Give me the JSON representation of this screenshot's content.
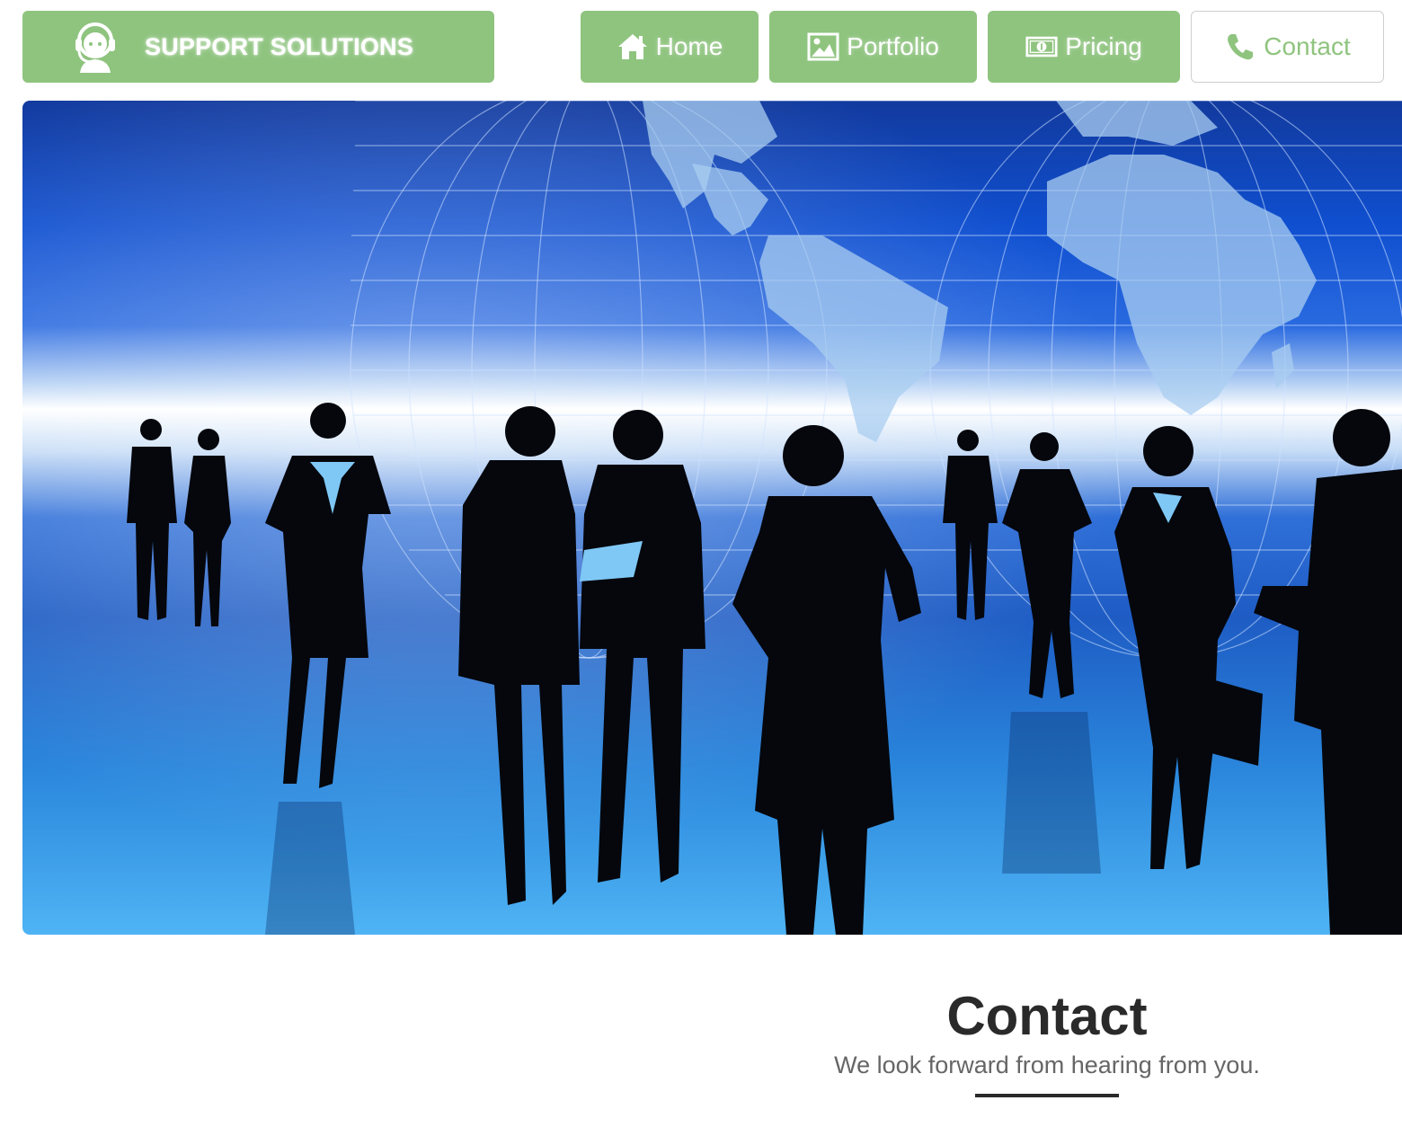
{
  "brand": {
    "title": "SUPPORT SOLUTIONS",
    "icon": "support-agent-icon"
  },
  "nav": {
    "items": [
      {
        "label": "Home",
        "icon": "home-icon"
      },
      {
        "label": "Portfolio",
        "icon": "image-icon"
      },
      {
        "label": "Pricing",
        "icon": "money-icon"
      },
      {
        "label": "Contact",
        "icon": "phone-icon",
        "active": true
      }
    ]
  },
  "hero": {
    "image": "business people silhouettes in front of world map"
  },
  "contact": {
    "title": "Contact",
    "subtitle": "We look forward from hearing from you."
  },
  "colors": {
    "accent": "#8fc47f",
    "text_dark": "#2a2a2a",
    "text_muted": "#666666",
    "white": "#ffffff"
  }
}
